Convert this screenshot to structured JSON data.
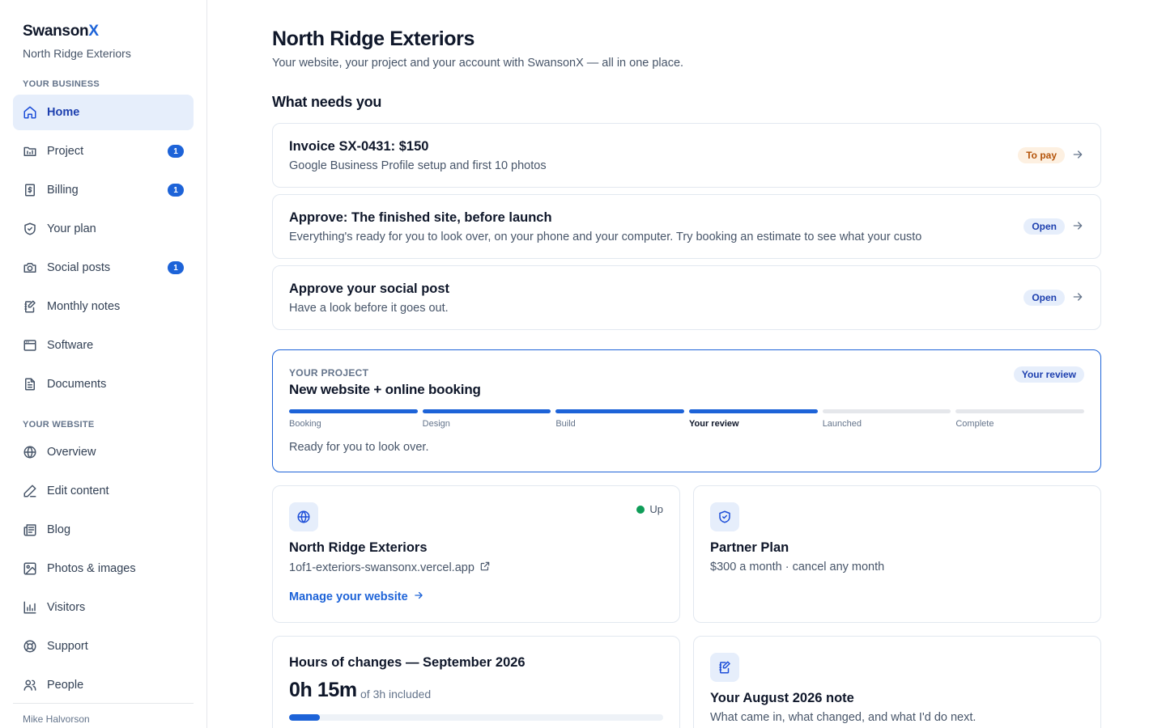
{
  "sidebar": {
    "brand_main": "Swanson",
    "brand_x": "X",
    "business_name": "North Ridge Exteriors",
    "section_business": "YOUR BUSINESS",
    "section_website": "YOUR WEBSITE",
    "business_items": [
      {
        "label": "Home",
        "icon": "home-icon",
        "active": true
      },
      {
        "label": "Project",
        "icon": "project-icon",
        "badge": "1"
      },
      {
        "label": "Billing",
        "icon": "billing-icon",
        "badge": "1"
      },
      {
        "label": "Your plan",
        "icon": "shield-icon"
      },
      {
        "label": "Social posts",
        "icon": "camera-icon",
        "badge": "1"
      },
      {
        "label": "Monthly notes",
        "icon": "notes-icon"
      },
      {
        "label": "Software",
        "icon": "window-icon"
      },
      {
        "label": "Documents",
        "icon": "document-icon"
      }
    ],
    "website_items": [
      {
        "label": "Overview",
        "icon": "globe-icon"
      },
      {
        "label": "Edit content",
        "icon": "pen-icon"
      },
      {
        "label": "Blog",
        "icon": "newspaper-icon"
      },
      {
        "label": "Photos & images",
        "icon": "image-icon"
      },
      {
        "label": "Visitors",
        "icon": "chart-icon"
      },
      {
        "label": "Support",
        "icon": "lifebuoy-icon"
      },
      {
        "label": "People",
        "icon": "people-icon"
      }
    ],
    "user_name": "Mike Halvorson"
  },
  "header": {
    "title": "North Ridge Exteriors",
    "subtitle": "Your website, your project and your account with SwansonX — all in one place."
  },
  "needs": {
    "title": "What needs you",
    "items": [
      {
        "title": "Invoice SX-0431: $150",
        "subtitle": "Google Business Profile setup and first 10 photos",
        "status": "To pay"
      },
      {
        "title": "Approve: The finished site, before launch",
        "subtitle": "Everything's ready for you to look over, on your phone and your computer. Try booking an estimate to see what your custo",
        "status": "Open"
      },
      {
        "title": "Approve your social post",
        "subtitle": "Have a look before it goes out.",
        "status": "Open"
      }
    ]
  },
  "project": {
    "label": "YOUR PROJECT",
    "title": "New website + online booking",
    "status": "Your review",
    "stages": [
      {
        "label": "Booking",
        "done": true
      },
      {
        "label": "Design",
        "done": true
      },
      {
        "label": "Build",
        "done": true
      },
      {
        "label": "Your review",
        "done": true,
        "current": true
      },
      {
        "label": "Launched",
        "done": false
      },
      {
        "label": "Complete",
        "done": false
      }
    ],
    "note": "Ready for you to look over."
  },
  "website_card": {
    "status": "Up",
    "status_color": "#0f9d58",
    "title": "North Ridge Exteriors",
    "url": "1of1-exteriors-swansonx.vercel.app",
    "link": "Manage your website"
  },
  "plan_card": {
    "title": "Partner Plan",
    "subtitle": "$300 a month · cancel any month"
  },
  "hours_card": {
    "title": "Hours of changes — September 2026",
    "used": "0h 15m",
    "included": "of 3h included",
    "progress": 0.083
  },
  "note_card": {
    "title": "Your August 2026 note",
    "subtitle": "What came in, what changed, and what I'd do next."
  },
  "colors": {
    "accent": "#1d63d8",
    "active_bg": "#e6eefb",
    "pay_bg": "#fdf0e1",
    "pay_text": "#b45309"
  }
}
